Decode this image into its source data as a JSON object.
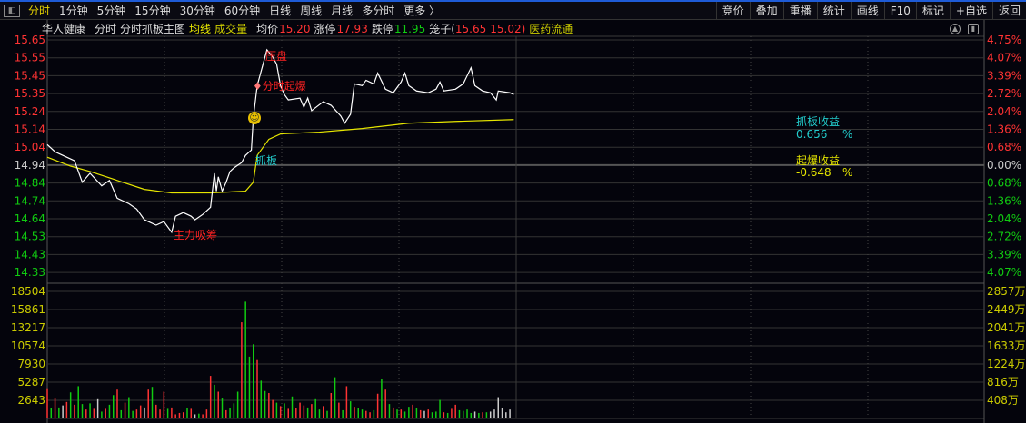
{
  "toolbar": {
    "timeframes": [
      "分时",
      "1分钟",
      "5分钟",
      "15分钟",
      "30分钟",
      "60分钟",
      "日线",
      "周线",
      "月线",
      "多分时",
      "更多 〉"
    ],
    "active": "分时",
    "right_buttons": [
      "竞价",
      "叠加",
      "重播",
      "统计",
      "画线",
      "F10",
      "标记",
      "+自选",
      "返回"
    ]
  },
  "info": {
    "stock": "华人健康",
    "mode": "分时",
    "template": "分时抓板主图",
    "avg_line": "均线",
    "volume": "成交量",
    "avg_price_label": "均价",
    "avg_price": "15.20",
    "limit_up_label": "涨停",
    "limit_up": "17.93",
    "limit_down_label": "跌停",
    "limit_down": "11.95",
    "cage_label": "笼子(",
    "cage_high": "15.65",
    "cage_low": "15.02)",
    "sector": "医药流通"
  },
  "annotations": {
    "suppress": "压盘",
    "burst": "分时起爆",
    "grab": "抓板",
    "accumulate": "主力吸筹"
  },
  "stats": {
    "grab_label": "抓板收益",
    "grab_value": "0.656",
    "grab_unit": "%",
    "burst_label": "起爆收益",
    "burst_value": "-0.648",
    "burst_unit": "%"
  },
  "colors": {
    "up": "#ff3333",
    "down": "#11cc11",
    "price_line": "#ffffff",
    "avg_line": "#e6e600",
    "grid": "#3a3a3a"
  },
  "chart_data": {
    "type": "line",
    "prev_close": 14.94,
    "ylim": [
      14.33,
      15.65
    ],
    "y_ticks": [
      "15.65",
      "15.55",
      "15.45",
      "15.35",
      "15.24",
      "15.14",
      "15.04",
      "14.94",
      "14.84",
      "14.74",
      "14.64",
      "14.53",
      "14.43",
      "14.33"
    ],
    "pct_ticks": [
      "4.75%",
      "4.07%",
      "3.39%",
      "2.72%",
      "2.04%",
      "1.36%",
      "0.68%",
      "0.00%",
      "0.68%",
      "1.36%",
      "2.04%",
      "2.72%",
      "3.39%",
      "4.07%"
    ],
    "vol_ticks": [
      "18504",
      "15861",
      "13217",
      "10574",
      "7930",
      "5287",
      "2643"
    ],
    "vol_amount_ticks": [
      "2857万",
      "2449万",
      "2041万",
      "1633万",
      "1224万",
      "816万",
      "408万"
    ],
    "x_minutes_total": 241,
    "price": [
      [
        0,
        15.06
      ],
      [
        2,
        15.02
      ],
      [
        4,
        15.0
      ],
      [
        7,
        14.97
      ],
      [
        9,
        14.85
      ],
      [
        11,
        14.9
      ],
      [
        14,
        14.83
      ],
      [
        16,
        14.86
      ],
      [
        18,
        14.76
      ],
      [
        21,
        14.73
      ],
      [
        23,
        14.7
      ],
      [
        25,
        14.64
      ],
      [
        28,
        14.61
      ],
      [
        30,
        14.63
      ],
      [
        32,
        14.57
      ],
      [
        33,
        14.66
      ],
      [
        35,
        14.68
      ],
      [
        37,
        14.66
      ],
      [
        38,
        14.64
      ],
      [
        40,
        14.67
      ],
      [
        42,
        14.71
      ],
      [
        43,
        14.9
      ],
      [
        43.5,
        14.8
      ],
      [
        44,
        14.88
      ],
      [
        45,
        14.8
      ],
      [
        46,
        14.85
      ],
      [
        47,
        14.91
      ],
      [
        48,
        14.93
      ],
      [
        50,
        14.96
      ],
      [
        51,
        15.0
      ],
      [
        52.5,
        15.03
      ],
      [
        53,
        15.21
      ],
      [
        54,
        15.39
      ],
      [
        55.5,
        15.51
      ],
      [
        56.5,
        15.59
      ],
      [
        58,
        15.55
      ],
      [
        59,
        15.51
      ],
      [
        60,
        15.39
      ],
      [
        61,
        15.34
      ],
      [
        62,
        15.31
      ],
      [
        65,
        15.32
      ],
      [
        66,
        15.27
      ],
      [
        67,
        15.32
      ],
      [
        68,
        15.25
      ],
      [
        71,
        15.3
      ],
      [
        73,
        15.28
      ],
      [
        75.5,
        15.22
      ],
      [
        76.5,
        15.18
      ],
      [
        78,
        15.23
      ],
      [
        79,
        15.4
      ],
      [
        81,
        15.39
      ],
      [
        82,
        15.42
      ],
      [
        84,
        15.4
      ],
      [
        85,
        15.46
      ],
      [
        87,
        15.37
      ],
      [
        89,
        15.35
      ],
      [
        91,
        15.41
      ],
      [
        92,
        15.46
      ],
      [
        93,
        15.39
      ],
      [
        95,
        15.36
      ],
      [
        98,
        15.35
      ],
      [
        100,
        15.37
      ],
      [
        101,
        15.41
      ],
      [
        102,
        15.36
      ],
      [
        105,
        15.37
      ],
      [
        107,
        15.4
      ],
      [
        109,
        15.49
      ],
      [
        110,
        15.39
      ],
      [
        112,
        15.36
      ],
      [
        114,
        15.35
      ],
      [
        115.5,
        15.31
      ],
      [
        116,
        15.36
      ],
      [
        119,
        15.35
      ],
      [
        120,
        15.34
      ]
    ],
    "avg": [
      [
        0,
        14.99
      ],
      [
        6,
        14.94
      ],
      [
        11,
        14.91
      ],
      [
        18,
        14.86
      ],
      [
        25,
        14.81
      ],
      [
        32,
        14.79
      ],
      [
        42,
        14.79
      ],
      [
        51,
        14.8
      ],
      [
        53,
        14.85
      ],
      [
        54,
        15.0
      ],
      [
        57,
        15.09
      ],
      [
        60,
        15.12
      ],
      [
        70,
        15.13
      ],
      [
        81,
        15.15
      ],
      [
        93,
        15.18
      ],
      [
        105,
        15.19
      ],
      [
        120,
        15.2
      ]
    ],
    "volume": [
      4400,
      1500,
      2900,
      1600,
      1900,
      2400,
      3800,
      2000,
      4700,
      2100,
      1300,
      2200,
      1400,
      2800,
      1000,
      1400,
      2000,
      3400,
      4200,
      1200,
      2300,
      3100,
      1100,
      1300,
      1900,
      1600,
      4200,
      4600,
      2000,
      1300,
      3900,
      1400,
      1600,
      600,
      800,
      900,
      1500,
      1400,
      600,
      700,
      600,
      1300,
      6200,
      4900,
      3900,
      2900,
      1200,
      1500,
      2200,
      3900,
      14000,
      17000,
      9000,
      10800,
      8500,
      5500,
      4000,
      3700,
      2700,
      2300,
      1800,
      2200,
      1400,
      3200,
      1500,
      2300,
      1900,
      1600,
      2100,
      2800,
      1300,
      1800,
      1100,
      3700,
      6000,
      2300,
      1200,
      4700,
      2500,
      1700,
      1500,
      1300,
      1100,
      900,
      1200,
      3600,
      5800,
      4200,
      2100,
      1600,
      1300,
      1300,
      1000,
      1700,
      2000,
      1500,
      1200,
      1100,
      1300,
      900,
      1000,
      2700,
      900,
      800,
      1400,
      2000,
      1200,
      1100,
      1300,
      800,
      1000,
      800,
      900,
      900,
      1000,
      1300,
      3100,
      1500,
      900,
      1300
    ],
    "volume_dir": "rgrgwrgrggrgrwgrggrgrggrrwrgrrrgrrrrgrwgrrrgrgrgggrgggrggrrgrgrgrrrgrggrgrgrgrgrggrrgrgrgrgrggrgrwrgggrgrrggggwgrg"
  }
}
